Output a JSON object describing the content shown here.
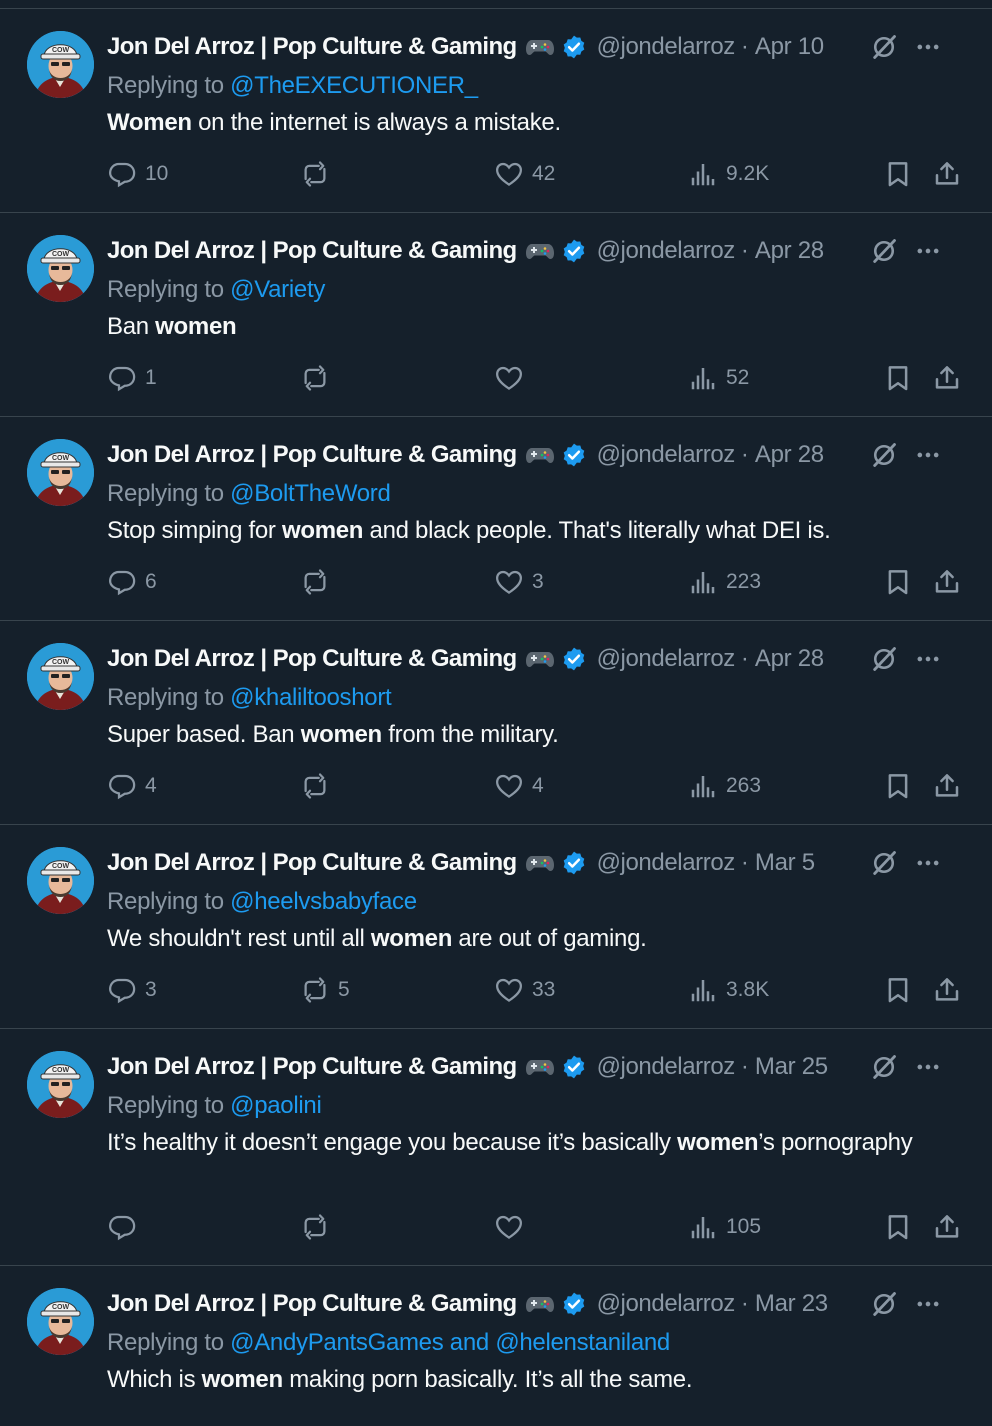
{
  "author": {
    "name": "Jon Del Arroz | Pop Culture & Gaming",
    "handle": "@jondelarroz",
    "separator": "·"
  },
  "reply_prefix": "Replying to",
  "colors": {
    "background": "#15202b",
    "divider": "#38444d",
    "muted": "#8b98a5",
    "link": "#1d9bf0",
    "verified": "#1d9bf0"
  },
  "icons": {
    "reply": "reply-icon",
    "retweet": "retweet-icon",
    "like": "heart-icon",
    "views": "views-icon",
    "bookmark": "bookmark-icon",
    "share": "share-icon",
    "grok": "grok-icon",
    "more": "more-icon",
    "verified": "verified-badge-icon",
    "gamepad": "gamepad-emoji-icon"
  },
  "tweets": [
    {
      "date": "Apr 10",
      "reply_to": "@TheEXECUTIONER_",
      "text_segments": [
        {
          "text": "Women",
          "bold": true
        },
        {
          "text": " on the internet is always a mistake.",
          "bold": false
        }
      ],
      "replies": "10",
      "retweets": "",
      "likes": "42",
      "views": "9.2K"
    },
    {
      "date": "Apr 28",
      "reply_to": "@Variety",
      "text_segments": [
        {
          "text": "Ban ",
          "bold": false
        },
        {
          "text": "women",
          "bold": true
        }
      ],
      "replies": "1",
      "retweets": "",
      "likes": "",
      "views": "52"
    },
    {
      "date": "Apr 28",
      "reply_to": "@BoltTheWord",
      "text_segments": [
        {
          "text": "Stop simping for ",
          "bold": false
        },
        {
          "text": "women",
          "bold": true
        },
        {
          "text": " and black people. That's literally what DEI is.",
          "bold": false
        }
      ],
      "replies": "6",
      "retweets": "",
      "likes": "3",
      "views": "223"
    },
    {
      "date": "Apr 28",
      "reply_to": "@khaliltooshort",
      "text_segments": [
        {
          "text": "Super based. Ban ",
          "bold": false
        },
        {
          "text": "women",
          "bold": true
        },
        {
          "text": " from the military.",
          "bold": false
        }
      ],
      "replies": "4",
      "retweets": "",
      "likes": "4",
      "views": "263"
    },
    {
      "date": "Mar 5",
      "reply_to": "@heelvsbabyface",
      "text_segments": [
        {
          "text": "We shouldn't rest until all ",
          "bold": false
        },
        {
          "text": "women",
          "bold": true
        },
        {
          "text": " are out of gaming.",
          "bold": false
        }
      ],
      "replies": "3",
      "retweets": "5",
      "likes": "33",
      "views": "3.8K"
    },
    {
      "date": "Mar 25",
      "reply_to": "@paolini",
      "text_segments": [
        {
          "text": "It’s healthy it doesn’t engage you because it’s basically ",
          "bold": false
        },
        {
          "text": "women",
          "bold": true
        },
        {
          "text": "’s pornography",
          "bold": false
        }
      ],
      "replies": "",
      "retweets": "",
      "likes": "",
      "views": "105"
    },
    {
      "date": "Mar 23",
      "reply_to": "@AndyPantsGames and @helenstaniland",
      "text_segments": [
        {
          "text": "Which is ",
          "bold": false
        },
        {
          "text": "women",
          "bold": true
        },
        {
          "text": " making porn basically. It’s all the same.",
          "bold": false
        }
      ],
      "replies": "",
      "retweets": "",
      "likes": "",
      "views": ""
    }
  ]
}
